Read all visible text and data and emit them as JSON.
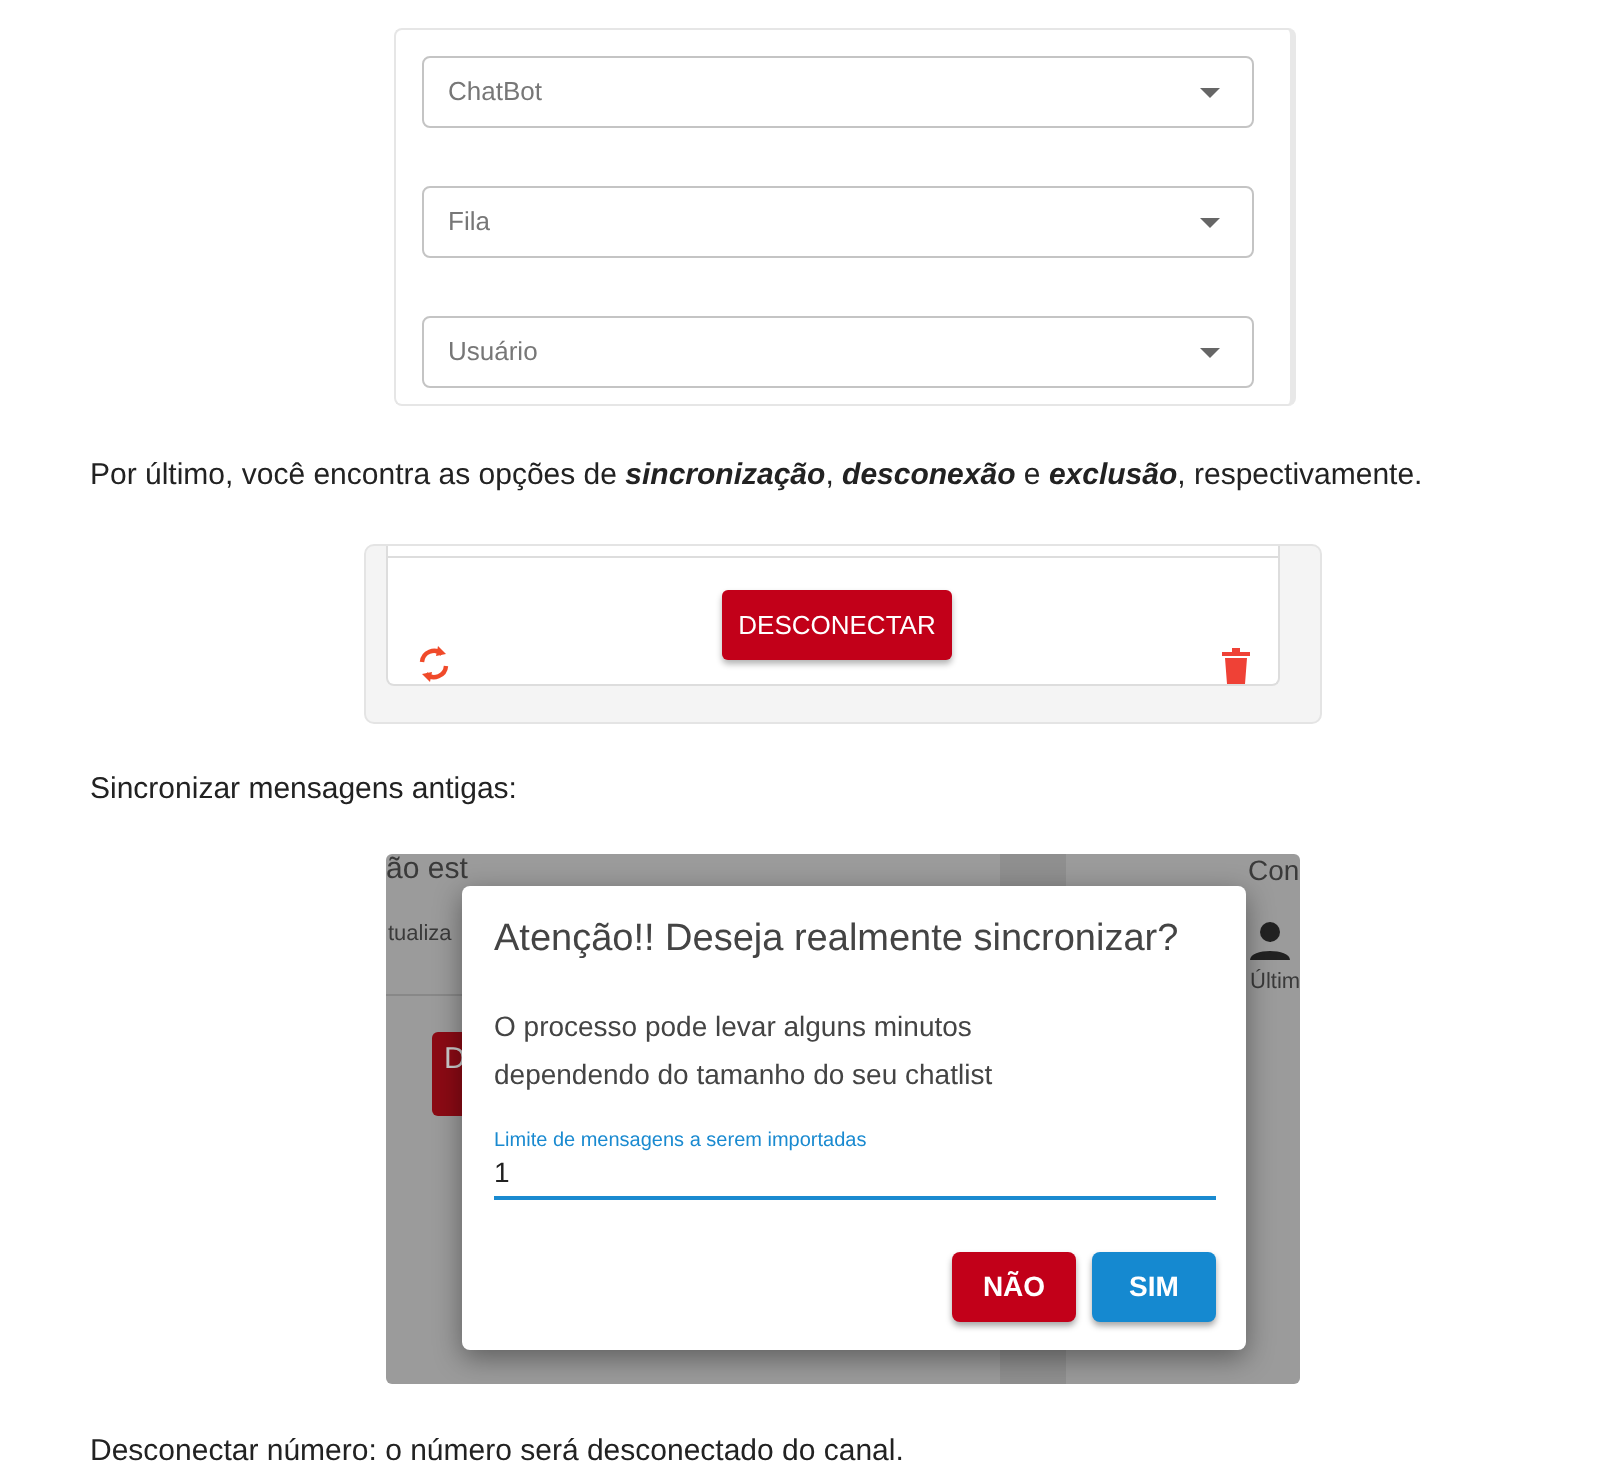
{
  "filters": [
    {
      "label": "ChatBot"
    },
    {
      "label": "Fila"
    },
    {
      "label": "Usuário"
    }
  ],
  "intro": "Por último, você encontra as opções de **sincronização**, **desconexão** e **exclusão**, respectivamente.",
  "connection_card": {
    "button": "DESCONECTAR"
  },
  "sync_caption": "Sincronizar mensagens antigas:",
  "screenshot": {
    "background_texts": [
      {
        "kind": "title",
        "text": "ão est"
      },
      {
        "kind": "subtitle",
        "text": "tualiza"
      },
      {
        "kind": "button",
        "text": "D"
      },
      {
        "kind": "side-title",
        "text": "Con"
      },
      {
        "kind": "side-sub",
        "text": "Últim"
      }
    ],
    "dialog": {
      "title": "Atenção!! Deseja realmente sincronizar?",
      "body": "O processo pode levar alguns minutos dependendo do tamanho do seu chatlist",
      "field": {
        "label": "Limite de mensagens a serem importadas",
        "value": "1"
      },
      "buttons": [
        {
          "kind": "cancel",
          "label": "NÃO"
        },
        {
          "kind": "confirm",
          "label": "SIM"
        }
      ]
    }
  },
  "outro": "Desconectar número: o número será desconectado do canal."
}
